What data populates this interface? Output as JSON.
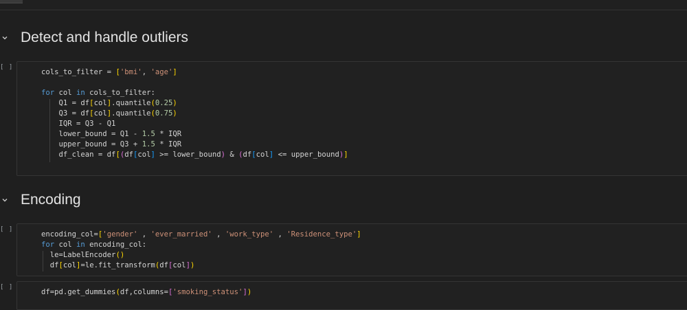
{
  "sections": [
    {
      "title": "Detect and handle outliers"
    },
    {
      "title": "Encoding"
    }
  ],
  "cells": [
    {
      "run_label": "[ ]"
    },
    {
      "run_label": "[ ]"
    },
    {
      "run_label": "[ ]"
    }
  ],
  "icons": {
    "section_toggle": "chevron-down-icon"
  },
  "colors": {
    "background": "#1f1f1f",
    "keyword": "#569cd6",
    "string": "#ce9178",
    "number": "#b5cea8",
    "bracket_gold": "#ffd700",
    "bracket_purple": "#da70d6",
    "bracket_blue": "#179fff"
  },
  "code": {
    "cell1": [
      {
        "text": "cols_to_filter = ['bmi', 'age']"
      },
      {
        "text": ""
      },
      {
        "text": "for col in cols_to_filter:"
      },
      {
        "text": "    Q1 = df[col].quantile(0.25)"
      },
      {
        "text": "    Q3 = df[col].quantile(0.75)"
      },
      {
        "text": "    IQR = Q3 - Q1"
      },
      {
        "text": "    lower_bound = Q1 - 1.5 * IQR"
      },
      {
        "text": "    upper_bound = Q3 + 1.5 * IQR"
      },
      {
        "text": "    df_clean = df[(df[col] >= lower_bound) & (df[col] <= upper_bound)]"
      }
    ],
    "cell2": [
      {
        "text": "encoding_col=['gender' , 'ever_married' , 'work_type' , 'Residence_type']"
      },
      {
        "text": "for col in encoding_col:"
      },
      {
        "text": "  le=LabelEncoder()"
      },
      {
        "text": "  df[col]=le.fit_transform(df[col])"
      }
    ],
    "cell3": [
      {
        "text": "df=pd.get_dummies(df,columns=['smoking_status'])"
      }
    ]
  }
}
